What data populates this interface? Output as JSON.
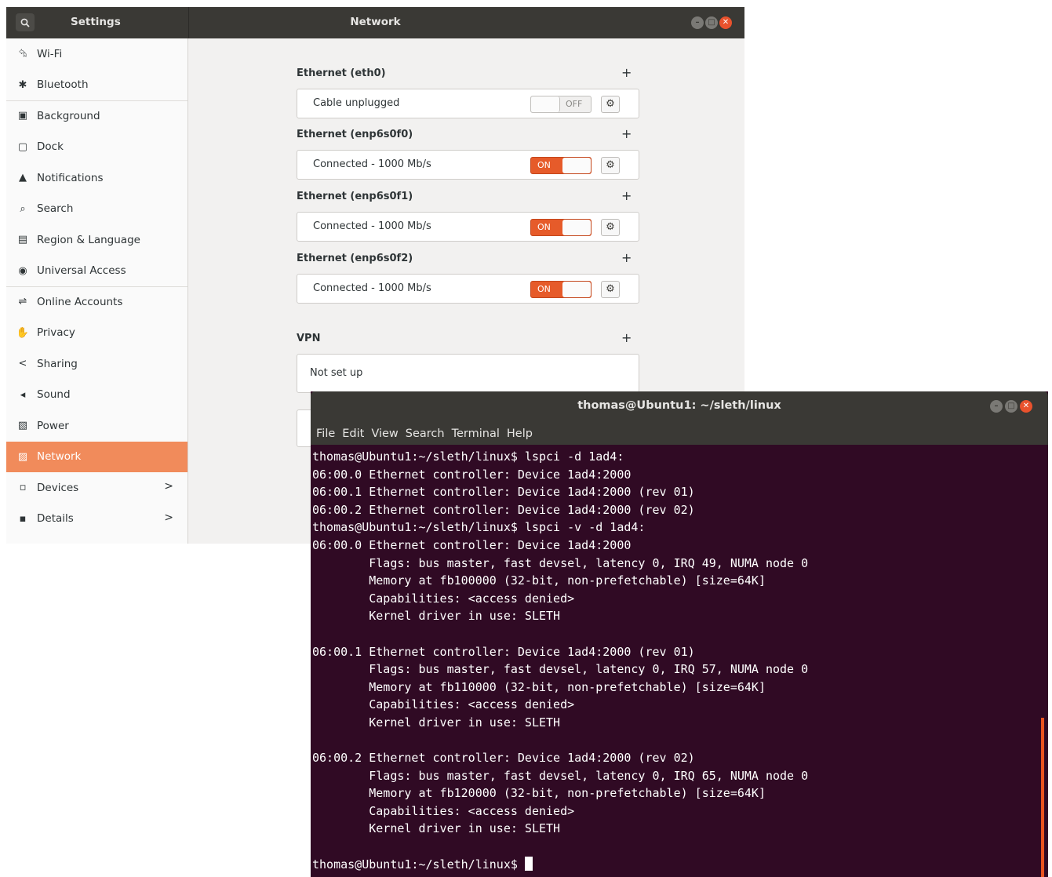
{
  "settings": {
    "app_title": "Settings",
    "window_title": "Network",
    "sidebar": [
      {
        "label": "Wi-Fi",
        "icon": "wifi-icon",
        "glyph": "⮲"
      },
      {
        "label": "Bluetooth",
        "icon": "bluetooth-icon",
        "glyph": "✱"
      },
      {
        "label": "Background",
        "icon": "background-icon",
        "glyph": "▣"
      },
      {
        "label": "Dock",
        "icon": "dock-icon",
        "glyph": "▢"
      },
      {
        "label": "Notifications",
        "icon": "bell-icon",
        "glyph": "▲"
      },
      {
        "label": "Search",
        "icon": "search-icon",
        "glyph": "⌕"
      },
      {
        "label": "Region & Language",
        "icon": "region-icon",
        "glyph": "▤"
      },
      {
        "label": "Universal Access",
        "icon": "accessibility-icon",
        "glyph": "◉"
      },
      {
        "label": "Online Accounts",
        "icon": "online-accounts-icon",
        "glyph": "⇌"
      },
      {
        "label": "Privacy",
        "icon": "hand-icon",
        "glyph": "✋"
      },
      {
        "label": "Sharing",
        "icon": "share-icon",
        "glyph": "<"
      },
      {
        "label": "Sound",
        "icon": "speaker-icon",
        "glyph": "◂"
      },
      {
        "label": "Power",
        "icon": "power-icon",
        "glyph": "▧"
      },
      {
        "label": "Network",
        "icon": "network-icon",
        "glyph": "▨"
      },
      {
        "label": "Devices",
        "icon": "devices-icon",
        "glyph": "▫",
        "chevron": ">"
      },
      {
        "label": "Details",
        "icon": "info-icon",
        "glyph": "▪",
        "chevron": ">"
      }
    ],
    "sections": [
      {
        "title": "Ethernet (eth0)",
        "plus": "+",
        "status": "Cable unplugged",
        "toggle": "OFF"
      },
      {
        "title": "Ethernet (enp6s0f0)",
        "plus": "+",
        "status": "Connected - 1000 Mb/s",
        "toggle": "ON"
      },
      {
        "title": "Ethernet (enp6s0f1)",
        "plus": "+",
        "status": "Connected - 1000 Mb/s",
        "toggle": "ON"
      },
      {
        "title": "Ethernet (enp6s0f2)",
        "plus": "+",
        "status": "Connected - 1000 Mb/s",
        "toggle": "ON"
      }
    ],
    "vpn": {
      "title": "VPN",
      "plus": "+",
      "status": "Not set up"
    }
  },
  "terminal": {
    "window_title": "thomas@Ubuntu1: ~/sleth/linux",
    "menu": [
      "File",
      "Edit",
      "View",
      "Search",
      "Terminal",
      "Help"
    ],
    "lines": [
      "thomas@Ubuntu1:~/sleth/linux$ lspci -d 1ad4:",
      "06:00.0 Ethernet controller: Device 1ad4:2000",
      "06:00.1 Ethernet controller: Device 1ad4:2000 (rev 01)",
      "06:00.2 Ethernet controller: Device 1ad4:2000 (rev 02)",
      "thomas@Ubuntu1:~/sleth/linux$ lspci -v -d 1ad4:",
      "06:00.0 Ethernet controller: Device 1ad4:2000",
      "        Flags: bus master, fast devsel, latency 0, IRQ 49, NUMA node 0",
      "        Memory at fb100000 (32-bit, non-prefetchable) [size=64K]",
      "        Capabilities: <access denied>",
      "        Kernel driver in use: SLETH",
      "",
      "06:00.1 Ethernet controller: Device 1ad4:2000 (rev 01)",
      "        Flags: bus master, fast devsel, latency 0, IRQ 57, NUMA node 0",
      "        Memory at fb110000 (32-bit, non-prefetchable) [size=64K]",
      "        Capabilities: <access denied>",
      "        Kernel driver in use: SLETH",
      "",
      "06:00.2 Ethernet controller: Device 1ad4:2000 (rev 02)",
      "        Flags: bus master, fast devsel, latency 0, IRQ 65, NUMA node 0",
      "        Memory at fb120000 (32-bit, non-prefetchable) [size=64K]",
      "        Capabilities: <access denied>",
      "        Kernel driver in use: SLETH",
      "",
      "thomas@Ubuntu1:~/sleth/linux$ "
    ]
  },
  "colors": {
    "accent": "#e95420",
    "active_sidebar": "#f18b5b",
    "terminal_bg": "#300a24"
  }
}
